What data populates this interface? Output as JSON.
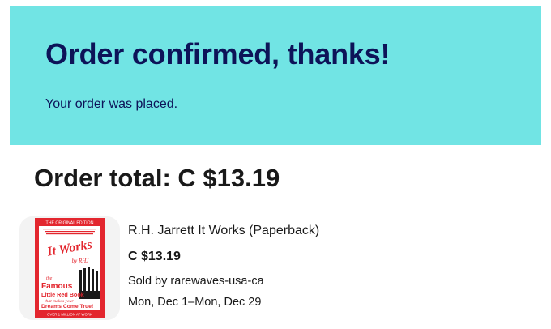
{
  "banner": {
    "title": "Order confirmed, thanks!",
    "subtitle": "Your order was placed.",
    "background_color": "#71e4e4",
    "text_color": "#0d1358"
  },
  "order": {
    "total_label": "Order total: C $13.19"
  },
  "item": {
    "title": "R.H. Jarrett It Works (Paperback)",
    "price": "C $13.19",
    "seller": "Sold by rarewaves-usa-ca",
    "delivery": "Mon, Dec 1–Mon, Dec 29",
    "cover": {
      "edition": "THE ORIGINAL EDITION",
      "title": "It Works",
      "author": "by RHJ",
      "line1": "the",
      "line2": "Famous",
      "line3": "Little Red Book",
      "line4": "that makes your",
      "line5": "Dreams Come True!",
      "footer": "OVER 1 MILLION AT WORK",
      "cover_color": "#e3262e"
    }
  }
}
